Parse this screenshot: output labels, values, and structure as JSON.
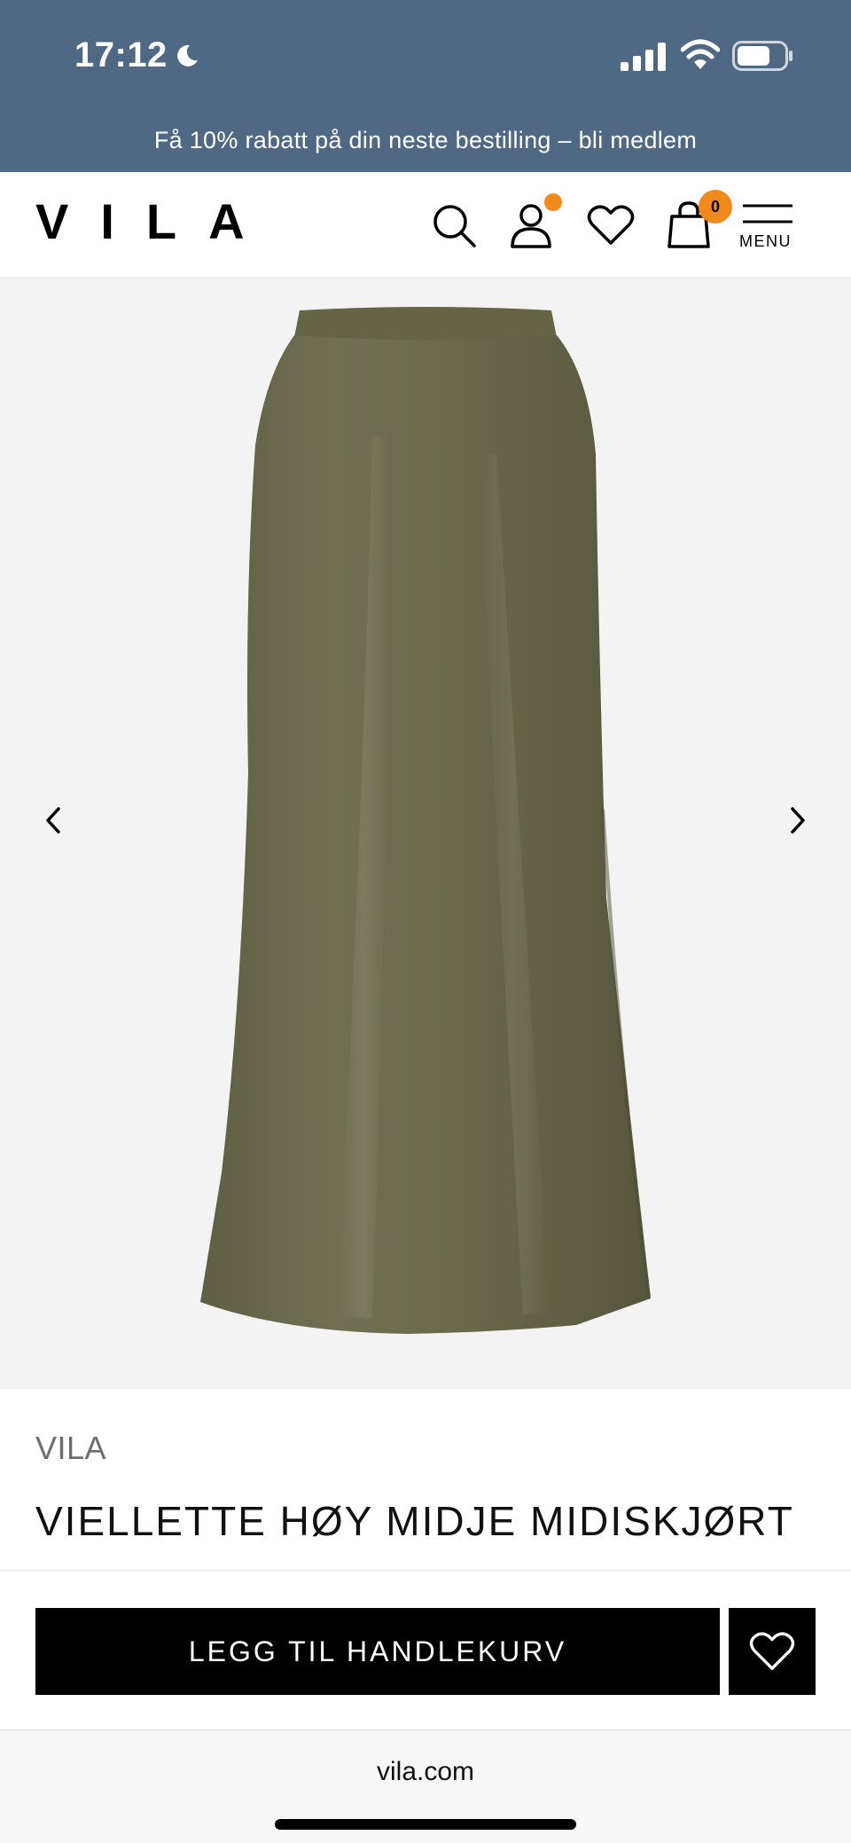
{
  "status_bar": {
    "time": "17:12",
    "icons": [
      "moon-icon",
      "signal-icon",
      "wifi-icon",
      "battery-icon"
    ]
  },
  "promo": {
    "text": "Få 10% rabatt på din neste bestilling – bli medlem"
  },
  "header": {
    "logo": "VILA",
    "cart_count": "0",
    "menu_label": "MENU",
    "icons": [
      "search-icon",
      "account-icon",
      "wishlist-icon",
      "bag-icon",
      "menu-icon"
    ],
    "accent_color": "#f08a1c"
  },
  "gallery": {
    "image_alt": "olive satin midi skirt",
    "product_color": "#6b6a4c",
    "icons": [
      "chevron-left-icon",
      "chevron-right-icon"
    ]
  },
  "product": {
    "brand": "VILA",
    "title": "VIELLETTE HØY MIDJE MIDISKJØRT"
  },
  "cta": {
    "add_to_cart": "LEGG TIL HANDLEKURV"
  },
  "browser": {
    "url": "vila.com"
  },
  "colors": {
    "status_bar": "#4f6884",
    "background": "#ffffff",
    "gallery_bg": "#f3f3f3",
    "button": "#000000"
  }
}
